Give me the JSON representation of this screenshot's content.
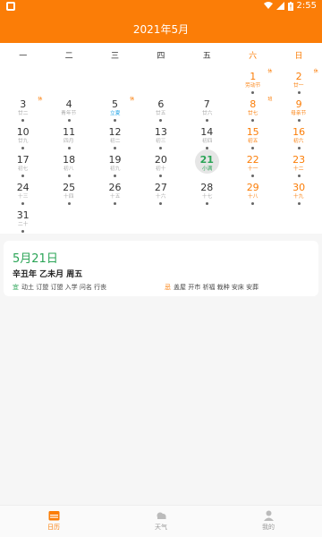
{
  "status": {
    "time": "2:55"
  },
  "header": {
    "title": "2021年5月"
  },
  "weekdays": [
    "一",
    "二",
    "三",
    "四",
    "五",
    "六",
    "日"
  ],
  "days": [
    {
      "d": "1",
      "l": "劳动节",
      "col": 5,
      "row": 0,
      "weekend": true,
      "festival": true,
      "mark": "休"
    },
    {
      "d": "2",
      "l": "廿一",
      "col": 6,
      "row": 0,
      "weekend": true,
      "mark": "休"
    },
    {
      "d": "3",
      "l": "廿二",
      "col": 0,
      "row": 1,
      "mark": "休"
    },
    {
      "d": "4",
      "l": "青年节",
      "col": 1,
      "row": 1
    },
    {
      "d": "5",
      "l": "立夏",
      "col": 2,
      "row": 1,
      "solar": true,
      "mark": "休"
    },
    {
      "d": "6",
      "l": "廿五",
      "col": 3,
      "row": 1
    },
    {
      "d": "7",
      "l": "廿六",
      "col": 4,
      "row": 1
    },
    {
      "d": "8",
      "l": "廿七",
      "col": 5,
      "row": 1,
      "weekend": true,
      "mark": "班"
    },
    {
      "d": "9",
      "l": "母亲节",
      "col": 6,
      "row": 1,
      "weekend": true
    },
    {
      "d": "10",
      "l": "廿九",
      "col": 0,
      "row": 2
    },
    {
      "d": "11",
      "l": "四月",
      "col": 1,
      "row": 2
    },
    {
      "d": "12",
      "l": "初二",
      "col": 2,
      "row": 2
    },
    {
      "d": "13",
      "l": "初三",
      "col": 3,
      "row": 2
    },
    {
      "d": "14",
      "l": "初四",
      "col": 4,
      "row": 2
    },
    {
      "d": "15",
      "l": "初五",
      "col": 5,
      "row": 2,
      "weekend": true
    },
    {
      "d": "16",
      "l": "初六",
      "col": 6,
      "row": 2,
      "weekend": true
    },
    {
      "d": "17",
      "l": "初七",
      "col": 0,
      "row": 3
    },
    {
      "d": "18",
      "l": "初八",
      "col": 1,
      "row": 3
    },
    {
      "d": "19",
      "l": "初九",
      "col": 2,
      "row": 3
    },
    {
      "d": "20",
      "l": "初十",
      "col": 3,
      "row": 3
    },
    {
      "d": "21",
      "l": "小满",
      "col": 4,
      "row": 3,
      "today": true
    },
    {
      "d": "22",
      "l": "十一",
      "col": 5,
      "row": 3,
      "weekend": true
    },
    {
      "d": "23",
      "l": "十二",
      "col": 6,
      "row": 3,
      "weekend": true
    },
    {
      "d": "24",
      "l": "十三",
      "col": 0,
      "row": 4
    },
    {
      "d": "25",
      "l": "十四",
      "col": 1,
      "row": 4
    },
    {
      "d": "26",
      "l": "十五",
      "col": 2,
      "row": 4
    },
    {
      "d": "27",
      "l": "十六",
      "col": 3,
      "row": 4
    },
    {
      "d": "28",
      "l": "十七",
      "col": 4,
      "row": 4
    },
    {
      "d": "29",
      "l": "十八",
      "col": 5,
      "row": 4,
      "weekend": true
    },
    {
      "d": "30",
      "l": "十九",
      "col": 6,
      "row": 4,
      "weekend": true
    },
    {
      "d": "31",
      "l": "二十",
      "col": 0,
      "row": 5
    }
  ],
  "detail": {
    "date": "5月21日",
    "ganzhi": "辛丑年 乙未月 周五",
    "yi_label": "宜",
    "yi": "动土 订盟 订盟 入学 问名 行丧",
    "ji_label": "忌",
    "ji": "盖屋 开市 祈福 栽种 安床 安葬"
  },
  "tabs": [
    {
      "label": "日历",
      "name": "calendar"
    },
    {
      "label": "天气",
      "name": "weather"
    },
    {
      "label": "我的",
      "name": "profile"
    }
  ],
  "colors": {
    "accent": "#fb7d07",
    "today": "#2aa456",
    "solar": "#1aa1e6"
  }
}
